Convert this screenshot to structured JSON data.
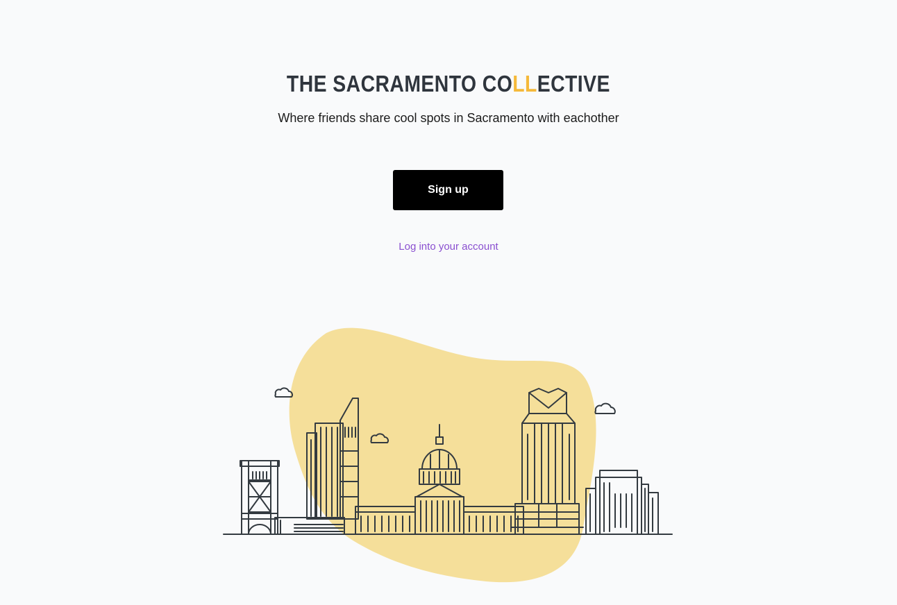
{
  "header": {
    "brand_prefix": "THE SACRAMENTO CO",
    "brand_accent": "LL",
    "brand_suffix": "ECTIVE",
    "tagline": "Where friends share cool spots in Sacramento with eachother"
  },
  "actions": {
    "signup_label": "Sign up",
    "login_label": "Log into your account"
  },
  "illustration": {
    "name": "sacramento-skyline",
    "blob_color": "#f5df9a",
    "line_color": "#333a40"
  },
  "colors": {
    "background": "#f9fafb",
    "brand_text": "#2f353d",
    "brand_accent": "#f5b93a",
    "button_bg": "#000000",
    "link": "#8a4fd0"
  }
}
